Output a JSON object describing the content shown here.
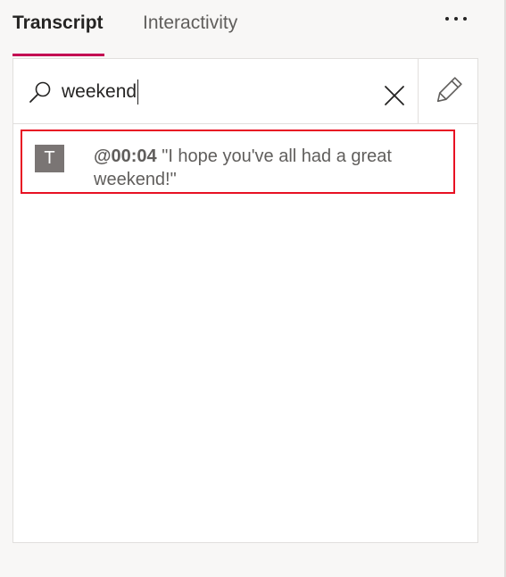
{
  "tabs": [
    {
      "label": "Transcript",
      "active": true
    },
    {
      "label": "Interactivity",
      "active": false
    }
  ],
  "more_button": {
    "icon": "ellipsis-icon",
    "label": "..."
  },
  "search": {
    "value": "weekend",
    "search_icon": "search-icon",
    "clear_icon": "close-icon"
  },
  "edit_button": {
    "icon": "pencil-icon"
  },
  "results": [
    {
      "badge": "T",
      "timestamp": "@00:04",
      "text": "\"I hope you've all had a great weekend!\""
    }
  ],
  "colors": {
    "accent": "#c30052",
    "highlight_border": "#e81123",
    "badge_bg": "#7a7574",
    "background": "#f8f7f6"
  }
}
